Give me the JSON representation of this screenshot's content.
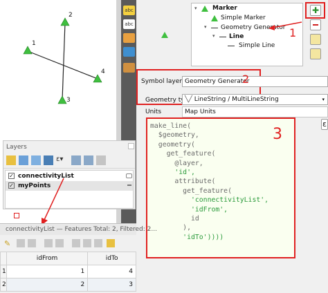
{
  "map_canvas": {
    "points": [
      {
        "label": "1"
      },
      {
        "label": "2"
      },
      {
        "label": "3"
      },
      {
        "label": "4"
      }
    ]
  },
  "symbol_tree": {
    "items": [
      "Marker",
      "Simple Marker",
      "Geometry Generator",
      "Line",
      "Simple Line"
    ]
  },
  "symbol_layer_type": {
    "label": "Symbol layer type",
    "value": "Geometry Generator"
  },
  "geometry_type": {
    "label": "Geometry type",
    "value": "LineString / MultiLineString"
  },
  "units": {
    "label": "Units",
    "value": "Map Units"
  },
  "expression": {
    "lines": [
      "make_line(",
      "  $geometry,",
      "  geometry(",
      "    get_feature(",
      "      @layer,",
      "      'id',",
      "      attribute(",
      "        get_feature(",
      "          'connectivityList',",
      "          'idFrom',",
      "          id",
      "        ),",
      "        'idTo'))))"
    ]
  },
  "annotations": [
    "1",
    "2",
    "3"
  ],
  "layers_panel": {
    "title": "Layers",
    "items": [
      "connectivityList",
      "myPoints"
    ]
  },
  "attribute_table": {
    "title": "connectivityList — Features Total: 2, Filtered: 2...",
    "columns": [
      "idFrom",
      "idTo"
    ],
    "rows": [
      {
        "num": "1",
        "cells": [
          "1",
          "4"
        ]
      },
      {
        "num": "2",
        "cells": [
          "2",
          "3"
        ]
      }
    ]
  },
  "colors": {
    "accent_red": "#e02020",
    "marker_green": "#3fbf3f"
  }
}
